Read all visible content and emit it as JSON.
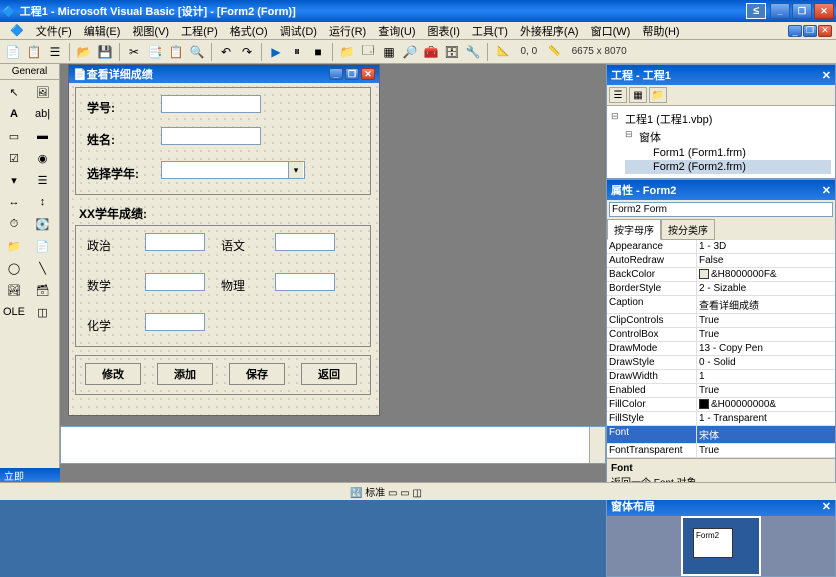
{
  "app": {
    "title": "工程1 - Microsoft Visual Basic [设计] - [Form2 (Form)]"
  },
  "menu": {
    "items": [
      "文件(F)",
      "编辑(E)",
      "视图(V)",
      "工程(P)",
      "格式(O)",
      "调试(D)",
      "运行(R)",
      "查询(U)",
      "图表(I)",
      "工具(T)",
      "外接程序(A)",
      "窗口(W)",
      "帮助(H)"
    ]
  },
  "toolbar2": {
    "coords": "0, 0",
    "size": "6675 x 8070"
  },
  "toolbox": {
    "title": "General"
  },
  "form": {
    "title": "查看详细成绩",
    "labels": {
      "sno": "学号:",
      "name": "姓名:",
      "year": "选择学年:",
      "yeargrade": "XX学年成绩:",
      "politics": "政治",
      "chinese": "语文",
      "math": "数学",
      "physics": "物理",
      "chemistry": "化学"
    },
    "buttons": {
      "modify": "修改",
      "add": "添加",
      "save": "保存",
      "back": "返回"
    }
  },
  "project": {
    "title": "工程 - 工程1",
    "root": "工程1 (工程1.vbp)",
    "folder": "窗体",
    "items": [
      "Form1 (Form1.frm)",
      "Form2 (Form2.frm)"
    ]
  },
  "properties": {
    "title": "属性 - Form2",
    "object": "Form2 Form",
    "tabs": {
      "alpha": "按字母序",
      "category": "按分类序"
    },
    "rows": [
      {
        "n": "Appearance",
        "v": "1 - 3D"
      },
      {
        "n": "AutoRedraw",
        "v": "False"
      },
      {
        "n": "BackColor",
        "v": "&H8000000F&",
        "swatch": "#ece9d8"
      },
      {
        "n": "BorderStyle",
        "v": "2 - Sizable"
      },
      {
        "n": "Caption",
        "v": "查看详细成绩"
      },
      {
        "n": "ClipControls",
        "v": "True"
      },
      {
        "n": "ControlBox",
        "v": "True"
      },
      {
        "n": "DrawMode",
        "v": "13 - Copy Pen"
      },
      {
        "n": "DrawStyle",
        "v": "0 - Solid"
      },
      {
        "n": "DrawWidth",
        "v": "1"
      },
      {
        "n": "Enabled",
        "v": "True"
      },
      {
        "n": "FillColor",
        "v": "&H00000000&",
        "swatch": "#000000"
      },
      {
        "n": "FillStyle",
        "v": "1 - Transparent"
      },
      {
        "n": "Font",
        "v": "宋体",
        "sel": true
      },
      {
        "n": "FontTransparent",
        "v": "True"
      }
    ],
    "desc": {
      "name": "Font",
      "text": "返回一个 Font 对象。"
    }
  },
  "layout": {
    "title": "窗体布局",
    "formname": "Form2"
  },
  "status": {
    "imme": "标准",
    "bluebar": "立即"
  }
}
